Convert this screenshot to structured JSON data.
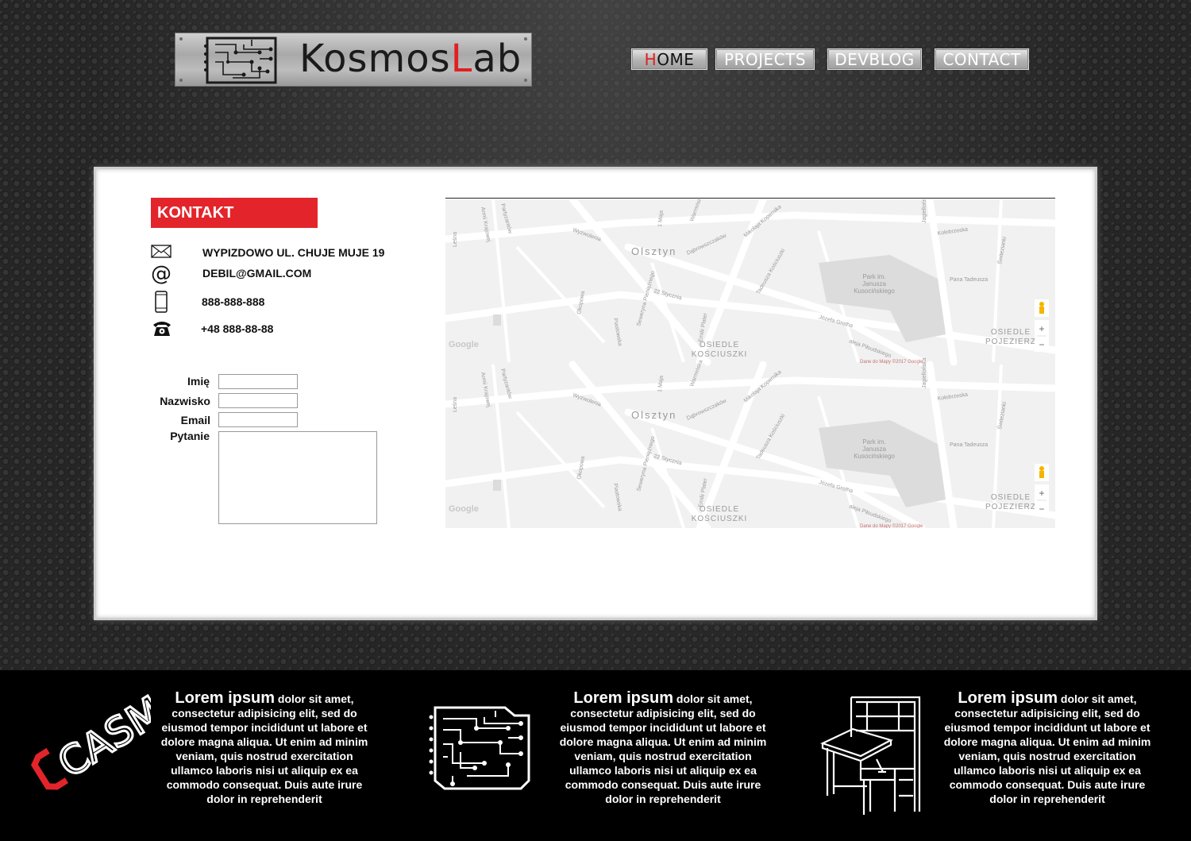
{
  "header": {
    "logo": {
      "brand_first": "K",
      "brand_middle": "osmos",
      "brand_red": "L",
      "brand_last": "ab",
      "icon": "circuit-chip-icon"
    },
    "nav": [
      {
        "label_first": "H",
        "label_rest": "OME",
        "active": true
      },
      {
        "label_first": "",
        "label_rest": "PROJECTS",
        "active": false
      },
      {
        "label_first": "",
        "label_rest": "DEVBLOG",
        "active": false
      },
      {
        "label_first": "",
        "label_rest": "CONTACT",
        "active": false
      }
    ]
  },
  "contact": {
    "heading": "KONTAKT",
    "address": "WYPIZDOWO UL. CHUJE MUJE 19",
    "email": "DEBIL@GMAIL.COM",
    "mobile": "888-888-888",
    "phone": "+48 888-88-88",
    "icons": [
      "envelope-icon",
      "at-sign-icon",
      "mobile-phone-icon",
      "telephone-icon"
    ]
  },
  "form": {
    "name_label": "Imię",
    "surname_label": "Nazwisko",
    "email_label": "Email",
    "question_label": "Pytanie",
    "name_value": "",
    "surname_value": "",
    "email_value": "",
    "question_value": ""
  },
  "map": {
    "city": "Olsztyn",
    "district_1a": "OSIEDLE",
    "district_1b": "KOŚCIUSZKI",
    "district_2a": "OSIEDLE",
    "district_2b": "POJEZIERZ",
    "park_1": "Park im.",
    "park_2": "Janusza",
    "park_3": "Kusocińskiego",
    "streets": [
      "Wyzwolenia",
      "Dąbrowszczaków",
      "Kołobrzeska",
      "Tadeusza Kościuszki",
      "Mikołaja Kopernika",
      "22 Stycznia",
      "Seweryna Pieniężnego",
      "Emilii Plater",
      "Józefa Grotha",
      "aleja Piłsudskiego",
      "Pana Tadeusza",
      "Okopowa",
      "Piastowska",
      "1 Maja",
      "Warmińska",
      "Leśna",
      "Armii Krajowej",
      "Świtezianki",
      "Jagiellońska",
      "Partyzantów"
    ],
    "google": "Google",
    "attribution": "Dane do Mapy ©2017 Google",
    "zoom_in": "+",
    "zoom_out": "−"
  },
  "footer": {
    "features": [
      {
        "icon": "casm-logo-icon",
        "lead": "Lorem ipsum",
        "text": "dolor sit amet, consectetur adipisicing elit, sed do eiusmod tempor incididunt ut labore et dolore magna aliqua. Ut enim ad minim veniam, quis nostrud exercitation ullamco laboris nisi ut aliquip ex ea commodo consequat. Duis aute irure dolor in reprehenderit"
      },
      {
        "icon": "circuit-board-icon",
        "lead": "Lorem ipsum",
        "text": "dolor sit amet, consectetur adipisicing elit, sed do eiusmod tempor incididunt ut labore et dolore magna aliqua. Ut enim ad minim veniam, quis nostrud exercitation ullamco laboris nisi ut aliquip ex ea commodo consequat. Duis aute irure dolor in reprehenderit"
      },
      {
        "icon": "workbench-desk-icon",
        "lead": "Lorem ipsum",
        "text": "dolor sit amet, consectetur adipisicing elit, sed do eiusmod tempor incididunt ut labore et dolore magna aliqua. Ut enim ad minim veniam, quis nostrud exercitation ullamco laboris nisi ut aliquip ex ea commodo consequat. Duis aute irure dolor in reprehenderit"
      }
    ],
    "casm_text": "CASM"
  },
  "colors": {
    "accent": "#e3242b",
    "panel": "#ffffff",
    "footer": "#000000"
  }
}
